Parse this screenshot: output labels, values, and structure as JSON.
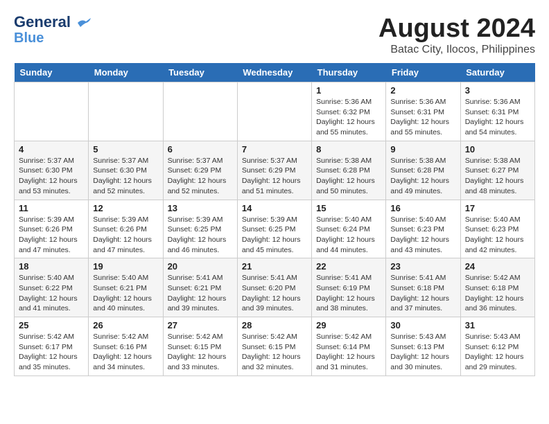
{
  "logo": {
    "line1": "General",
    "line2": "Blue"
  },
  "title": "August 2024",
  "subtitle": "Batac City, Ilocos, Philippines",
  "weekdays": [
    "Sunday",
    "Monday",
    "Tuesday",
    "Wednesday",
    "Thursday",
    "Friday",
    "Saturday"
  ],
  "weeks": [
    [
      {
        "day": "",
        "info": ""
      },
      {
        "day": "",
        "info": ""
      },
      {
        "day": "",
        "info": ""
      },
      {
        "day": "",
        "info": ""
      },
      {
        "day": "1",
        "info": "Sunrise: 5:36 AM\nSunset: 6:32 PM\nDaylight: 12 hours\nand 55 minutes."
      },
      {
        "day": "2",
        "info": "Sunrise: 5:36 AM\nSunset: 6:31 PM\nDaylight: 12 hours\nand 55 minutes."
      },
      {
        "day": "3",
        "info": "Sunrise: 5:36 AM\nSunset: 6:31 PM\nDaylight: 12 hours\nand 54 minutes."
      }
    ],
    [
      {
        "day": "4",
        "info": "Sunrise: 5:37 AM\nSunset: 6:30 PM\nDaylight: 12 hours\nand 53 minutes."
      },
      {
        "day": "5",
        "info": "Sunrise: 5:37 AM\nSunset: 6:30 PM\nDaylight: 12 hours\nand 52 minutes."
      },
      {
        "day": "6",
        "info": "Sunrise: 5:37 AM\nSunset: 6:29 PM\nDaylight: 12 hours\nand 52 minutes."
      },
      {
        "day": "7",
        "info": "Sunrise: 5:37 AM\nSunset: 6:29 PM\nDaylight: 12 hours\nand 51 minutes."
      },
      {
        "day": "8",
        "info": "Sunrise: 5:38 AM\nSunset: 6:28 PM\nDaylight: 12 hours\nand 50 minutes."
      },
      {
        "day": "9",
        "info": "Sunrise: 5:38 AM\nSunset: 6:28 PM\nDaylight: 12 hours\nand 49 minutes."
      },
      {
        "day": "10",
        "info": "Sunrise: 5:38 AM\nSunset: 6:27 PM\nDaylight: 12 hours\nand 48 minutes."
      }
    ],
    [
      {
        "day": "11",
        "info": "Sunrise: 5:39 AM\nSunset: 6:26 PM\nDaylight: 12 hours\nand 47 minutes."
      },
      {
        "day": "12",
        "info": "Sunrise: 5:39 AM\nSunset: 6:26 PM\nDaylight: 12 hours\nand 47 minutes."
      },
      {
        "day": "13",
        "info": "Sunrise: 5:39 AM\nSunset: 6:25 PM\nDaylight: 12 hours\nand 46 minutes."
      },
      {
        "day": "14",
        "info": "Sunrise: 5:39 AM\nSunset: 6:25 PM\nDaylight: 12 hours\nand 45 minutes."
      },
      {
        "day": "15",
        "info": "Sunrise: 5:40 AM\nSunset: 6:24 PM\nDaylight: 12 hours\nand 44 minutes."
      },
      {
        "day": "16",
        "info": "Sunrise: 5:40 AM\nSunset: 6:23 PM\nDaylight: 12 hours\nand 43 minutes."
      },
      {
        "day": "17",
        "info": "Sunrise: 5:40 AM\nSunset: 6:23 PM\nDaylight: 12 hours\nand 42 minutes."
      }
    ],
    [
      {
        "day": "18",
        "info": "Sunrise: 5:40 AM\nSunset: 6:22 PM\nDaylight: 12 hours\nand 41 minutes."
      },
      {
        "day": "19",
        "info": "Sunrise: 5:40 AM\nSunset: 6:21 PM\nDaylight: 12 hours\nand 40 minutes."
      },
      {
        "day": "20",
        "info": "Sunrise: 5:41 AM\nSunset: 6:21 PM\nDaylight: 12 hours\nand 39 minutes."
      },
      {
        "day": "21",
        "info": "Sunrise: 5:41 AM\nSunset: 6:20 PM\nDaylight: 12 hours\nand 39 minutes."
      },
      {
        "day": "22",
        "info": "Sunrise: 5:41 AM\nSunset: 6:19 PM\nDaylight: 12 hours\nand 38 minutes."
      },
      {
        "day": "23",
        "info": "Sunrise: 5:41 AM\nSunset: 6:18 PM\nDaylight: 12 hours\nand 37 minutes."
      },
      {
        "day": "24",
        "info": "Sunrise: 5:42 AM\nSunset: 6:18 PM\nDaylight: 12 hours\nand 36 minutes."
      }
    ],
    [
      {
        "day": "25",
        "info": "Sunrise: 5:42 AM\nSunset: 6:17 PM\nDaylight: 12 hours\nand 35 minutes."
      },
      {
        "day": "26",
        "info": "Sunrise: 5:42 AM\nSunset: 6:16 PM\nDaylight: 12 hours\nand 34 minutes."
      },
      {
        "day": "27",
        "info": "Sunrise: 5:42 AM\nSunset: 6:15 PM\nDaylight: 12 hours\nand 33 minutes."
      },
      {
        "day": "28",
        "info": "Sunrise: 5:42 AM\nSunset: 6:15 PM\nDaylight: 12 hours\nand 32 minutes."
      },
      {
        "day": "29",
        "info": "Sunrise: 5:42 AM\nSunset: 6:14 PM\nDaylight: 12 hours\nand 31 minutes."
      },
      {
        "day": "30",
        "info": "Sunrise: 5:43 AM\nSunset: 6:13 PM\nDaylight: 12 hours\nand 30 minutes."
      },
      {
        "day": "31",
        "info": "Sunrise: 5:43 AM\nSunset: 6:12 PM\nDaylight: 12 hours\nand 29 minutes."
      }
    ]
  ]
}
